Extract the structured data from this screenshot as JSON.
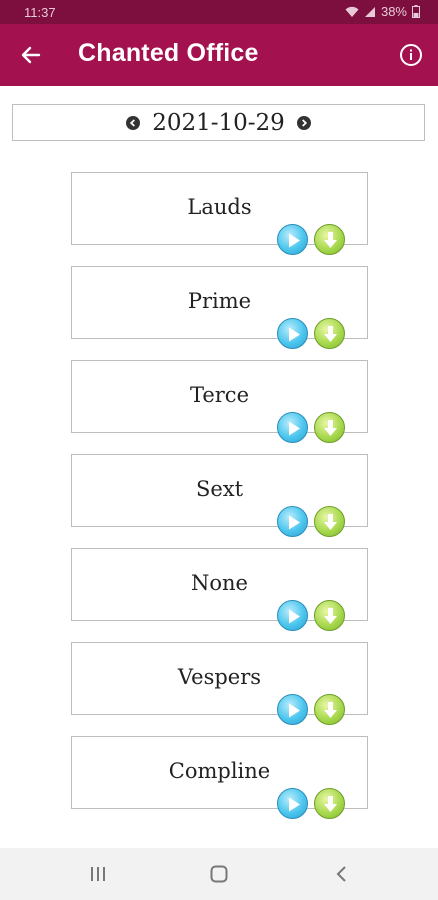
{
  "status_bar": {
    "time": "11:37",
    "battery": "38%"
  },
  "app_bar": {
    "title": "Chanted Office",
    "back_icon": "arrow-left-icon",
    "info_icon": "info-icon"
  },
  "date_selector": {
    "date": "2021-10-29"
  },
  "hours": [
    {
      "name": "Lauds"
    },
    {
      "name": "Prime"
    },
    {
      "name": "Terce"
    },
    {
      "name": "Sext"
    },
    {
      "name": "None"
    },
    {
      "name": "Vespers"
    },
    {
      "name": "Compline"
    }
  ],
  "colors": {
    "status_bar": "#7d0f3f",
    "app_bar": "#a3124f",
    "play": "#4cc6ee",
    "download": "#a8d94e"
  },
  "system_nav": [
    "recents-icon",
    "home-icon",
    "back-icon"
  ]
}
